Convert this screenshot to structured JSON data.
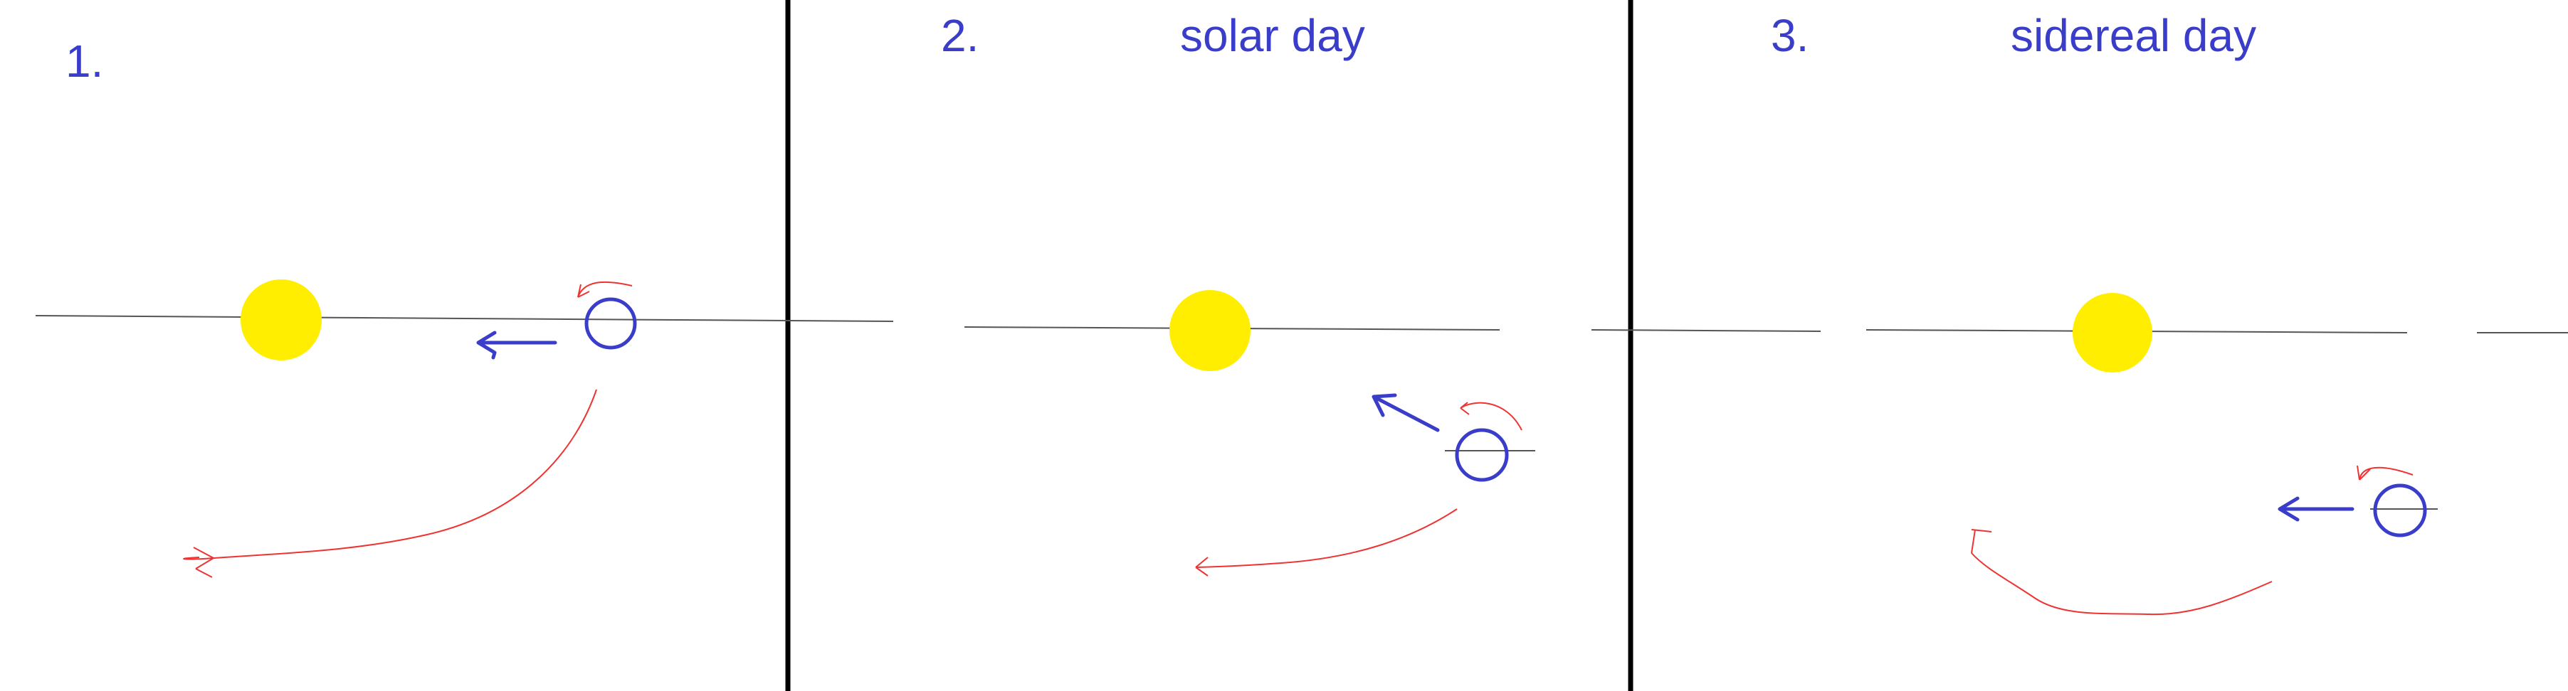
{
  "panels": [
    {
      "number": "1.",
      "title": ""
    },
    {
      "number": "2.",
      "title": "solar day"
    },
    {
      "number": "3.",
      "title": "sidereal day"
    }
  ],
  "colors": {
    "sun": "#ffee00",
    "earth": "#3a3dc9",
    "rotation_arrow": "#ee3333",
    "orbit_line": "#333333",
    "divider": "#000000",
    "label_text": "#3a3dc9"
  }
}
